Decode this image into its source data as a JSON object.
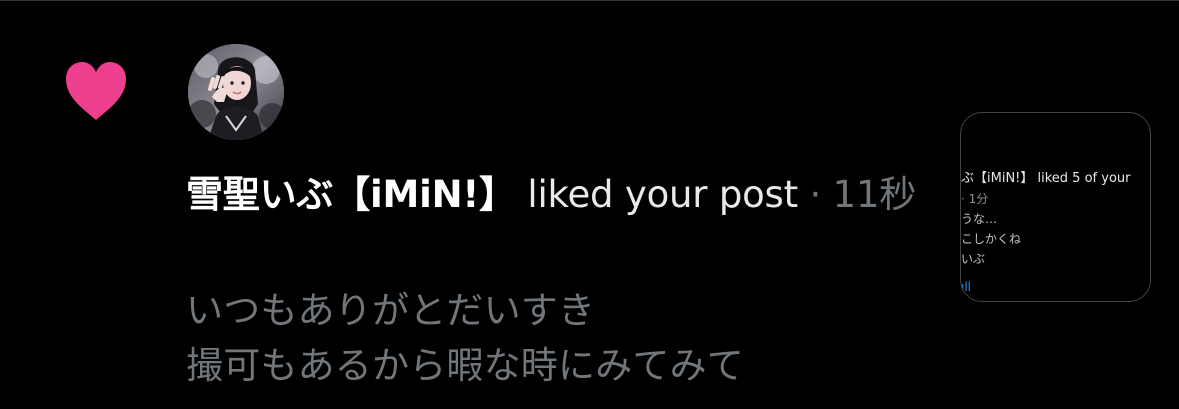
{
  "notification": {
    "user_name": "雪聖いぶ【iMiN!】",
    "action": " liked your post",
    "separator": " · ",
    "timestamp": "11秒",
    "post_lines": [
      "いつもありがとだいすき",
      "撮可もあるから暇な時にみてみて"
    ],
    "thumbnail": {
      "line_1": "ぶ【iMiN!】 liked 5 of your",
      "line_2": "· 1分",
      "line_3": "うな…",
      "line_4": "こしかくね",
      "line_5": "いぶ",
      "link": "ıll"
    }
  },
  "colors": {
    "background": "#000000",
    "heart": "#f91880",
    "primary_text": "#e7e9ea",
    "secondary_text": "#71767b",
    "divider": "#2f3336",
    "link": "#1d9bf0"
  },
  "icons": {
    "like": "heart-icon"
  }
}
